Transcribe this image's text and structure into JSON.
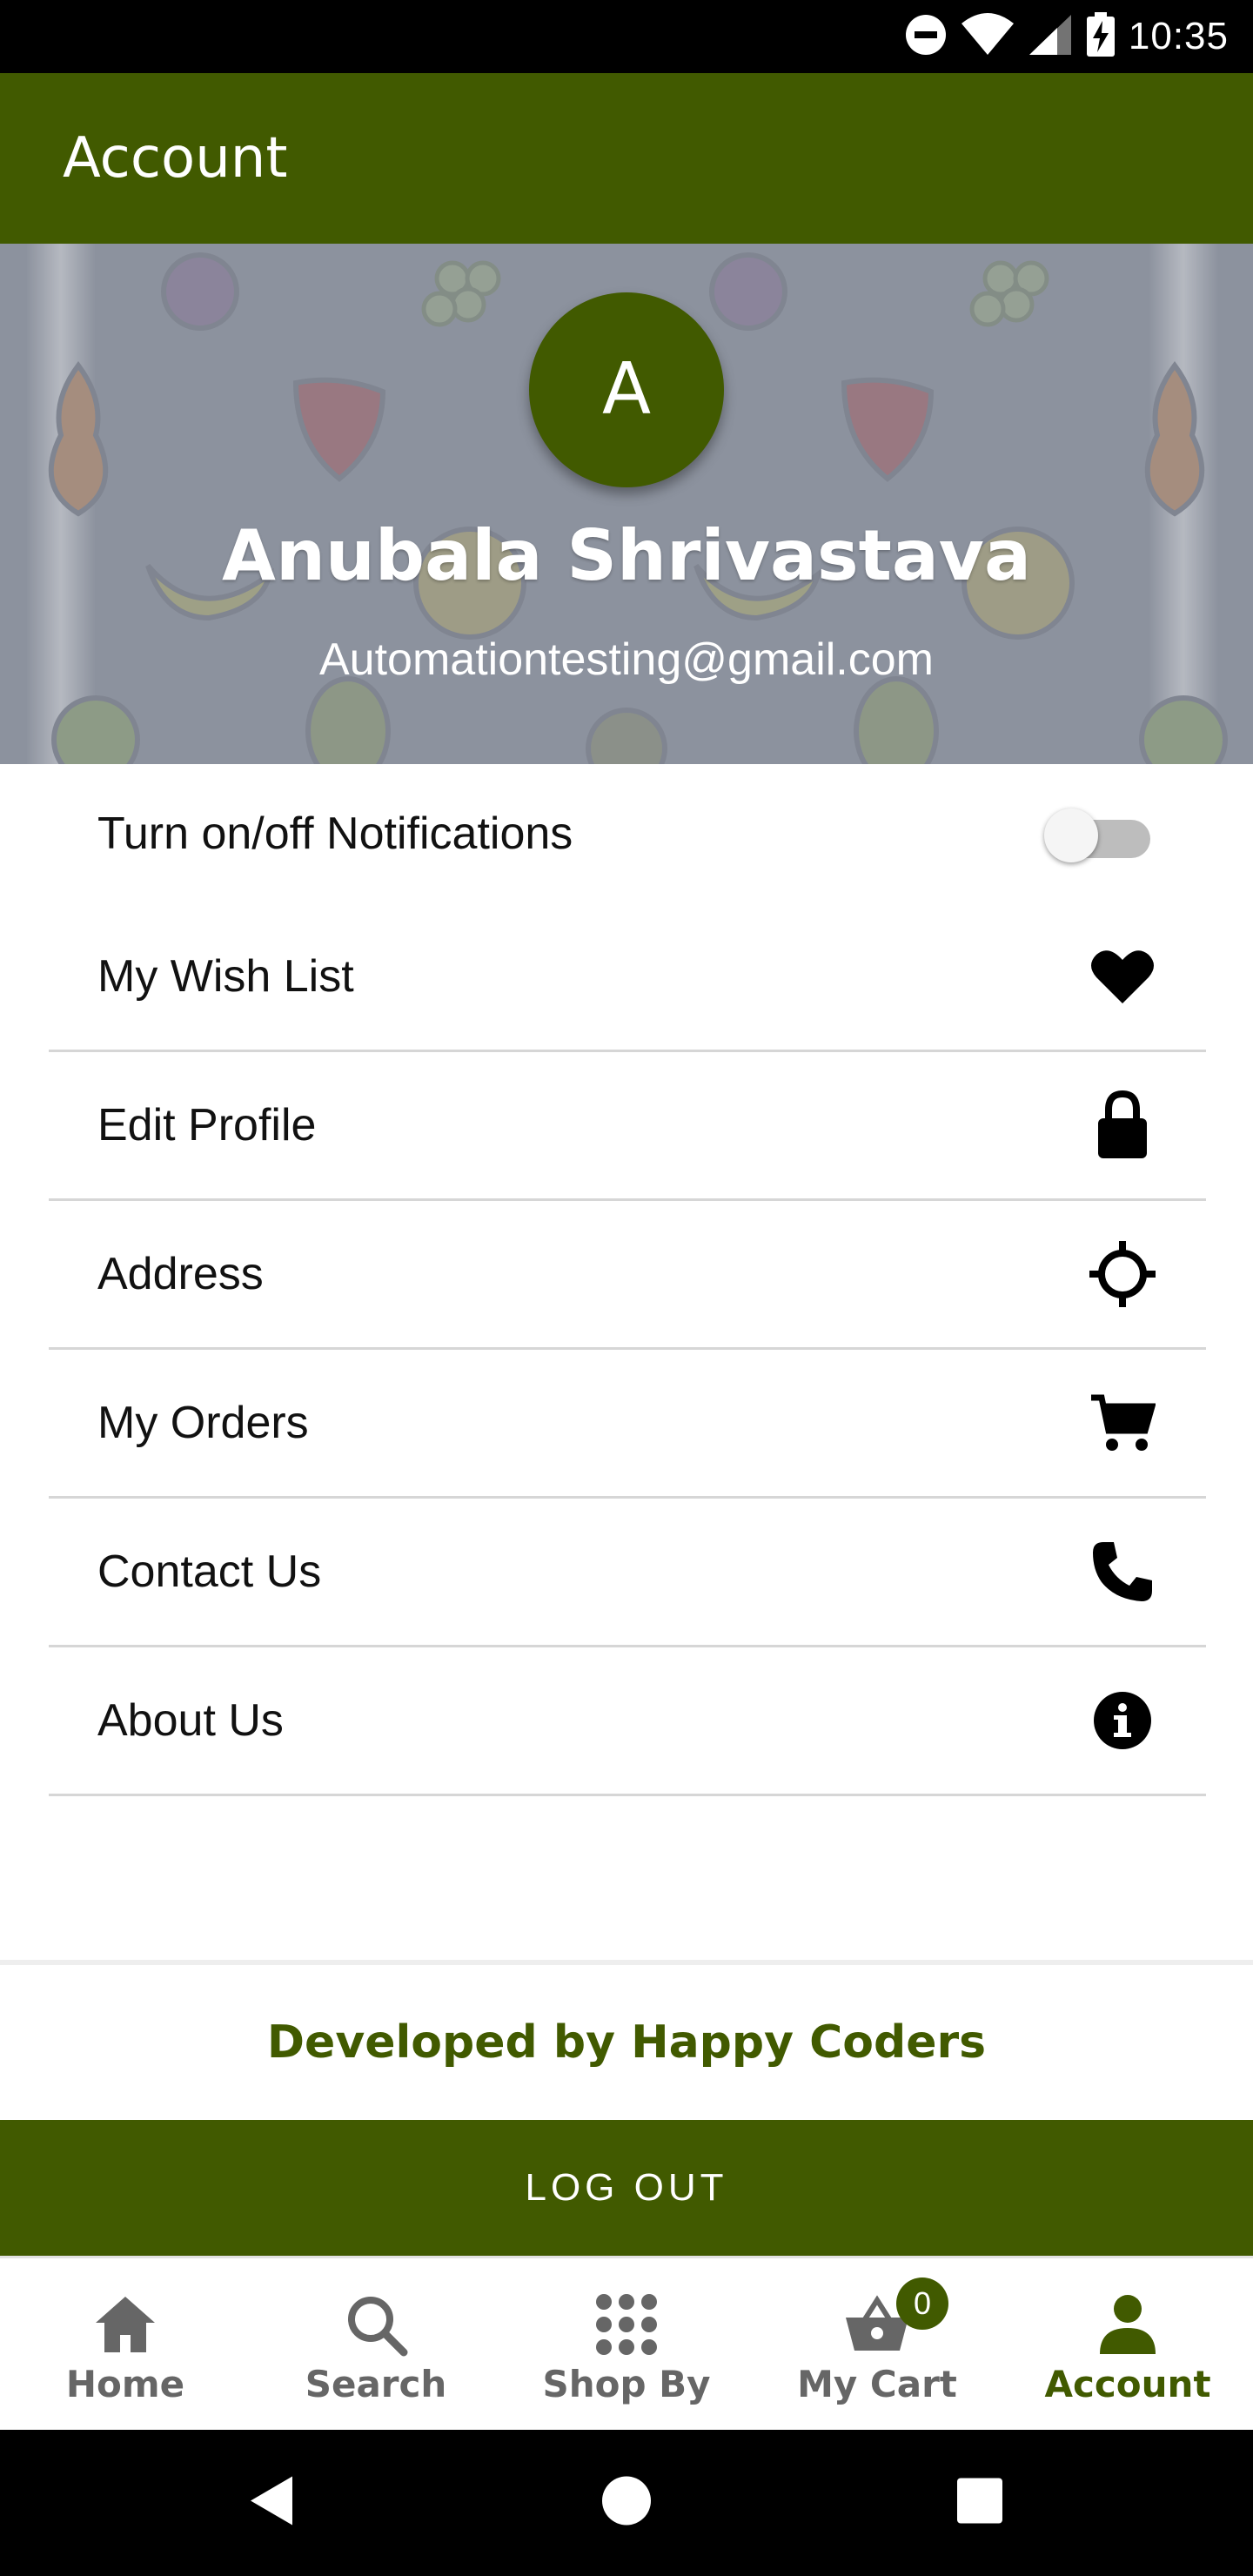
{
  "status_bar": {
    "time": "10:35",
    "icons": [
      "do-not-disturb-icon",
      "wifi-icon",
      "signal-icon",
      "battery-charging-icon"
    ]
  },
  "app_bar": {
    "title": "Account"
  },
  "profile": {
    "avatar_initial": "A",
    "name": "Anubala Shrivastava",
    "email": "Automationtesting@gmail.com"
  },
  "settings": {
    "notifications_label": "Turn on/off Notifications",
    "notifications_enabled": false,
    "items": [
      {
        "label": "My Wish List",
        "icon": "heart-icon"
      },
      {
        "label": "Edit Profile",
        "icon": "lock-icon"
      },
      {
        "label": "Address",
        "icon": "crosshair-icon"
      },
      {
        "label": "My Orders",
        "icon": "cart-icon"
      },
      {
        "label": "Contact Us",
        "icon": "phone-icon"
      },
      {
        "label": "About Us",
        "icon": "info-icon"
      }
    ]
  },
  "footer": {
    "developer_credit": "Developed by Happy Coders",
    "logout_label": "LOG OUT"
  },
  "bottom_nav": {
    "items": [
      {
        "label": "Home",
        "icon": "home-icon"
      },
      {
        "label": "Search",
        "icon": "search-icon"
      },
      {
        "label": "Shop By",
        "icon": "grid-icon"
      },
      {
        "label": "My Cart",
        "icon": "basket-icon"
      },
      {
        "label": "Account",
        "icon": "person-icon"
      }
    ],
    "cart_count": "0",
    "active": "Account"
  },
  "system_nav": {
    "icons": [
      "back-icon",
      "home-circle-icon",
      "recents-icon"
    ]
  },
  "colors": {
    "primary": "#415a00",
    "banner": "#8d939f",
    "inactive_nav": "#666666"
  }
}
